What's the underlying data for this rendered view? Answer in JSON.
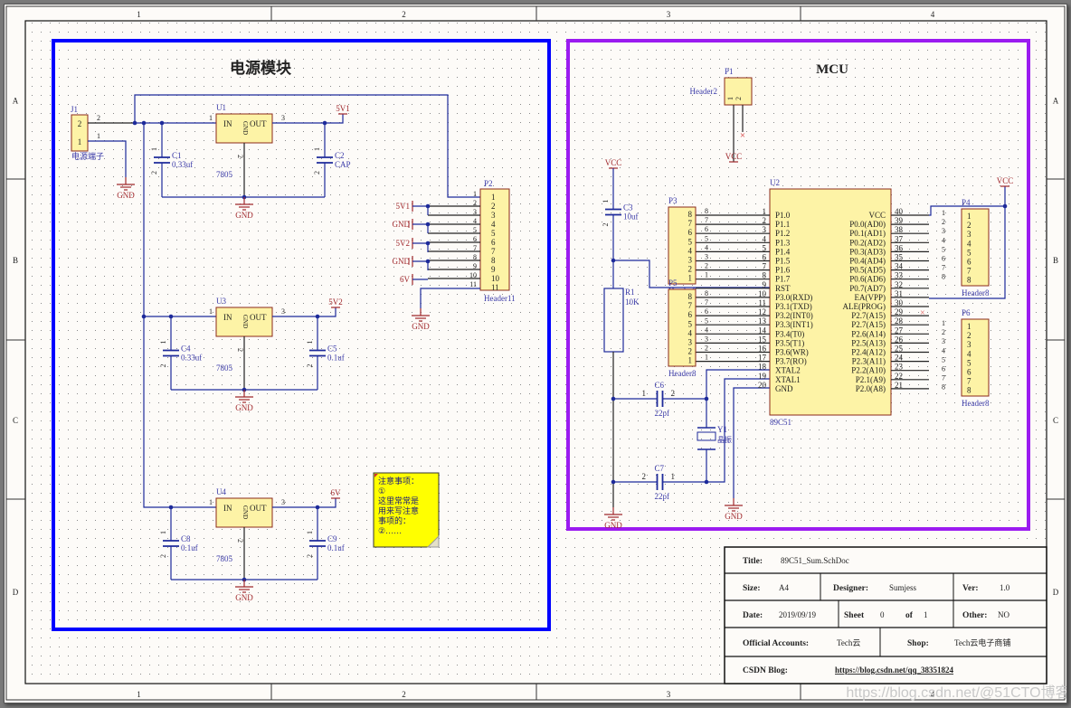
{
  "border": {
    "columns": [
      "1",
      "2",
      "3",
      "4"
    ],
    "rows": [
      "A",
      "B",
      "C",
      "D"
    ]
  },
  "power_module": {
    "title": "电源模块",
    "frame_color": "#0000ff",
    "j1": {
      "ref": "J1",
      "desc": "电源端子",
      "pins": [
        "2",
        "1"
      ]
    },
    "gnd_label": "GND",
    "regulators": [
      {
        "ref": "U1",
        "value": "7805",
        "in": "IN",
        "out": "OUT",
        "gnd": "GND",
        "pin_in": "1",
        "pin_out": "3",
        "pin_gnd": "2",
        "net": "5V1",
        "cin": {
          "ref": "C1",
          "value": "0.33uf"
        },
        "cout": {
          "ref": "C2",
          "value": "CAP"
        }
      },
      {
        "ref": "U3",
        "value": "7805",
        "in": "IN",
        "out": "OUT",
        "gnd": "GND",
        "pin_in": "1",
        "pin_out": "3",
        "pin_gnd": "2",
        "net": "5V2",
        "cin": {
          "ref": "C4",
          "value": "0.33uf"
        },
        "cout": {
          "ref": "C5",
          "value": "0.1uf"
        }
      },
      {
        "ref": "U4",
        "value": "7805",
        "in": "IN",
        "out": "OUT",
        "gnd": "GND",
        "pin_in": "1",
        "pin_out": "3",
        "pin_gnd": "2",
        "net": "6V",
        "cin": {
          "ref": "C8",
          "value": "0.1uf"
        },
        "cout": {
          "ref": "C9",
          "value": "0.1uf"
        }
      }
    ],
    "p2": {
      "ref": "P2",
      "value": "Header11",
      "pins": [
        "1",
        "2",
        "3",
        "4",
        "5",
        "6",
        "7",
        "8",
        "9",
        "10",
        "11"
      ],
      "nets": [
        "5V1",
        "GND",
        "5V2",
        "GND",
        "6V"
      ]
    },
    "note": {
      "lines": [
        "注意事项：",
        "①",
        "这里常常是",
        "用来写注意",
        "事项的：",
        "②……"
      ]
    }
  },
  "mcu": {
    "title": "MCU",
    "frame_color": "#9b1bf0",
    "vcc": "VCC",
    "gnd": "GND",
    "p1": {
      "ref": "P1",
      "value": "Header2",
      "pins": [
        "1",
        "2"
      ]
    },
    "c3": {
      "ref": "C3",
      "value": "10uf"
    },
    "r1": {
      "ref": "R1",
      "value": "10K"
    },
    "c6": {
      "ref": "C6",
      "value": "22pf"
    },
    "c7": {
      "ref": "C7",
      "value": "22pf"
    },
    "y1": {
      "ref": "Y1",
      "value": "晶振"
    },
    "u2": {
      "ref": "U2",
      "value": "89C51",
      "left_pins": [
        [
          "1",
          "P1.0"
        ],
        [
          "2",
          "P1.1"
        ],
        [
          "3",
          "P1.2"
        ],
        [
          "4",
          "P1.3"
        ],
        [
          "5",
          "P1.4"
        ],
        [
          "6",
          "P1.5"
        ],
        [
          "7",
          "P1.6"
        ],
        [
          "8",
          "P1.7"
        ],
        [
          "9",
          "RST"
        ],
        [
          "10",
          "P3.0(RXD)"
        ],
        [
          "11",
          "P3.1(TXD)"
        ],
        [
          "12",
          "P3.2(INT0)"
        ],
        [
          "13",
          "P3.3(INT1)"
        ],
        [
          "14",
          "P3.4(T0)"
        ],
        [
          "15",
          "P3.5(T1)"
        ],
        [
          "16",
          "P3.6(WR)"
        ],
        [
          "17",
          "P3.7(RO)"
        ],
        [
          "18",
          "XTAL2"
        ],
        [
          "19",
          "XTAL1"
        ],
        [
          "20",
          "GND"
        ]
      ],
      "right_pins": [
        [
          "40",
          "VCC"
        ],
        [
          "39",
          "P0.0(AD0)"
        ],
        [
          "38",
          "P0.1(AD1)"
        ],
        [
          "37",
          "P0.2(AD2)"
        ],
        [
          "36",
          "P0.3(AD3)"
        ],
        [
          "35",
          "P0.4(AD4)"
        ],
        [
          "34",
          "P0.5(AD5)"
        ],
        [
          "33",
          "P0.6(AD6)"
        ],
        [
          "32",
          "P0.7(AD7)"
        ],
        [
          "31",
          "EA(VPP)"
        ],
        [
          "30",
          "ALE(PROG)"
        ],
        [
          "29",
          "P2.7(A15)"
        ],
        [
          "28",
          "P2.7(A15)"
        ],
        [
          "27",
          "P2.6(A14)"
        ],
        [
          "26",
          "P2.5(A13)"
        ],
        [
          "25",
          "P2.4(A12)"
        ],
        [
          "24",
          "P2.3(A11)"
        ],
        [
          "23",
          "P2.2(A10)"
        ],
        [
          "22",
          "P2.1(A9)"
        ],
        [
          "21",
          "P2.0(A8)"
        ]
      ]
    },
    "p3": {
      "ref": "P3",
      "value": "Header8"
    },
    "p5": {
      "ref": "P5",
      "value": "Header8"
    },
    "p4": {
      "ref": "P4",
      "value": "Header8"
    },
    "p6": {
      "ref": "P6",
      "value": "Header8"
    }
  },
  "title_block": {
    "title_label": "Title:",
    "title_value": "89C51_Sum.SchDoc",
    "size_label": "Size:",
    "size_value": "A4",
    "designer_label": "Designer:",
    "designer_value": "Sumjess",
    "ver_label": "Ver:",
    "ver_value": "1.0",
    "date_label": "Date:",
    "date_value": "2019/09/19",
    "sheet_label": "Sheet",
    "sheet_value": "0",
    "of_label": "of",
    "of_value": "1",
    "other_label": "Other:",
    "other_value": "NO",
    "accounts_label": "Official Accounts:",
    "accounts_value": "Tech云",
    "shop_label": "Shop:",
    "shop_value": "Tech云电子商铺",
    "blog_label": "CSDN Blog:",
    "blog_value": "https://blog.csdn.net/qq_38351824"
  },
  "watermark": "https://blog.csdn.net/@51CTO博客"
}
